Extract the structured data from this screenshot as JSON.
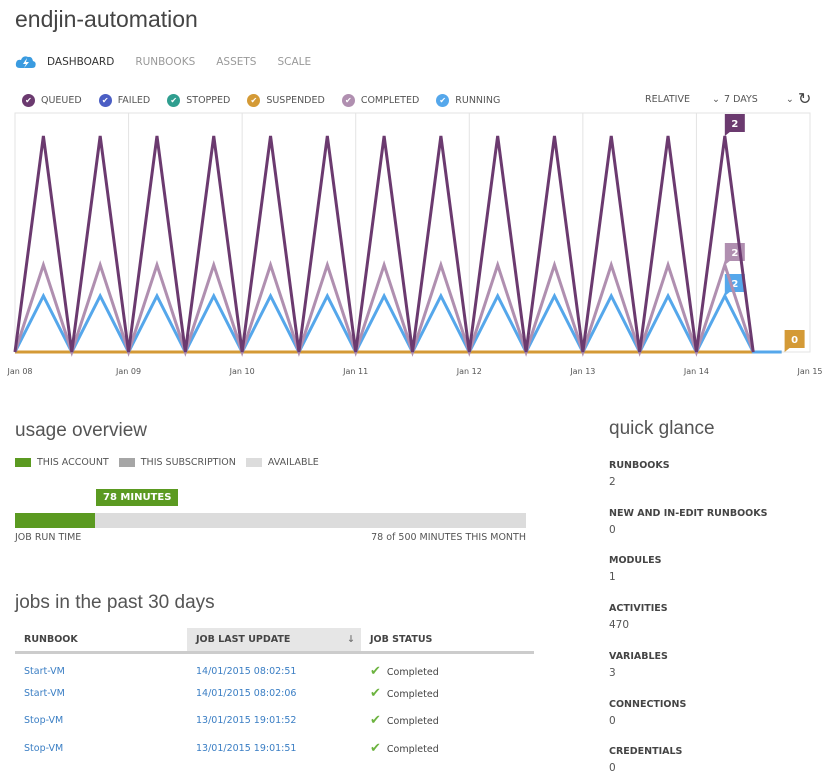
{
  "title": "endjin-automation",
  "nav": {
    "icon": "automation-cloud-icon",
    "tabs": [
      {
        "label": "DASHBOARD",
        "active": true
      },
      {
        "label": "RUNBOOKS"
      },
      {
        "label": "ASSETS"
      },
      {
        "label": "SCALE"
      }
    ]
  },
  "legend": [
    {
      "label": "QUEUED",
      "color": "#6b3a6f"
    },
    {
      "label": "FAILED",
      "color": "#4b5ec4"
    },
    {
      "label": "STOPPED",
      "color": "#2f9e8f"
    },
    {
      "label": "SUSPENDED",
      "color": "#d49a36"
    },
    {
      "label": "COMPLETED",
      "color": "#b08fb0"
    },
    {
      "label": "RUNNING",
      "color": "#55a7eb"
    }
  ],
  "controls": {
    "mode": "RELATIVE",
    "range": "7 DAYS"
  },
  "chart_data": {
    "type": "line",
    "x_ticks": [
      "Jan 08",
      "Jan 09",
      "Jan 10",
      "Jan 11",
      "Jan 12",
      "Jan 13",
      "Jan 14",
      "Jan 15"
    ],
    "xlim": [
      "2015-01-08 00:00",
      "2015-01-15 00:00"
    ],
    "grid": true,
    "x": [
      "2015-01-08 00:00",
      "2015-01-08 06:00",
      "2015-01-08 12:00",
      "2015-01-08 18:00",
      "2015-01-09 00:00",
      "2015-01-09 06:00",
      "2015-01-09 12:00",
      "2015-01-09 18:00",
      "2015-01-10 00:00",
      "2015-01-10 06:00",
      "2015-01-10 12:00",
      "2015-01-10 18:00",
      "2015-01-11 00:00",
      "2015-01-11 06:00",
      "2015-01-11 12:00",
      "2015-01-11 18:00",
      "2015-01-12 00:00",
      "2015-01-12 06:00",
      "2015-01-12 12:00",
      "2015-01-12 18:00",
      "2015-01-13 00:00",
      "2015-01-13 06:00",
      "2015-01-13 12:00",
      "2015-01-13 18:00",
      "2015-01-14 00:00",
      "2015-01-14 06:00",
      "2015-01-14 12:00",
      "2015-01-14 18:00"
    ],
    "series": [
      {
        "name": "SUSPENDED",
        "color": "#d49a36",
        "values": [
          0,
          0,
          0,
          0,
          0,
          0,
          0,
          0,
          0,
          0,
          0,
          0,
          0,
          0,
          0,
          0,
          0,
          0,
          0,
          0,
          0,
          0,
          0,
          0,
          0,
          0,
          0,
          0
        ],
        "end_label": "0"
      },
      {
        "name": "RUNNING",
        "color": "#55a7eb",
        "values": [
          0,
          2,
          0,
          2,
          0,
          2,
          0,
          2,
          0,
          2,
          0,
          2,
          0,
          2,
          0,
          2,
          0,
          2,
          0,
          2,
          0,
          2,
          0,
          2,
          0,
          2,
          0,
          0
        ],
        "end_label": "2"
      },
      {
        "name": "COMPLETED",
        "color": "#b08fb0",
        "values": [
          0,
          2,
          0,
          2,
          0,
          2,
          0,
          2,
          0,
          2,
          0,
          2,
          0,
          2,
          0,
          2,
          0,
          2,
          0,
          2,
          0,
          2,
          0,
          2,
          0,
          2,
          0,
          null
        ],
        "end_label": "2"
      },
      {
        "name": "QUEUED",
        "color": "#6b3a6f",
        "values": [
          0,
          2,
          0,
          2,
          0,
          2,
          0,
          2,
          0,
          2,
          0,
          2,
          0,
          2,
          0,
          2,
          0,
          2,
          0,
          2,
          0,
          2,
          0,
          2,
          0,
          2,
          0,
          null
        ],
        "end_label": "2"
      }
    ]
  },
  "usage": {
    "title": "usage overview",
    "legend": [
      {
        "label": "THIS ACCOUNT",
        "color": "#5b9a21"
      },
      {
        "label": "THIS SUBSCRIPTION",
        "color": "#a6a6a6"
      },
      {
        "label": "AVAILABLE",
        "color": "#dcdcdc"
      }
    ],
    "callout": "78 MINUTES",
    "used": 78,
    "total": 500,
    "label": "JOB RUN TIME",
    "summary": "78 of 500 MINUTES THIS MONTH"
  },
  "jobs": {
    "title": "jobs in the past 30 days",
    "columns": [
      "RUNBOOK",
      "JOB LAST UPDATE",
      "JOB STATUS"
    ],
    "rows": [
      {
        "runbook": "Start-VM",
        "updated": "14/01/2015 08:02:51",
        "status": "Completed"
      },
      {
        "runbook": "Start-VM",
        "updated": "14/01/2015 08:02:06",
        "status": "Completed"
      },
      {
        "runbook": "Stop-VM",
        "updated": "13/01/2015 19:01:52",
        "status": "Completed"
      },
      {
        "runbook": "Stop-VM",
        "updated": "13/01/2015 19:01:51",
        "status": "Completed"
      }
    ]
  },
  "quick": {
    "title": "quick glance",
    "items": [
      {
        "label": "RUNBOOKS",
        "value": "2"
      },
      {
        "label": "NEW AND IN-EDIT RUNBOOKS",
        "value": "0"
      },
      {
        "label": "MODULES",
        "value": "1"
      },
      {
        "label": "ACTIVITIES",
        "value": "470"
      },
      {
        "label": "VARIABLES",
        "value": "3"
      },
      {
        "label": "CONNECTIONS",
        "value": "0"
      },
      {
        "label": "CREDENTIALS",
        "value": "0"
      }
    ]
  }
}
